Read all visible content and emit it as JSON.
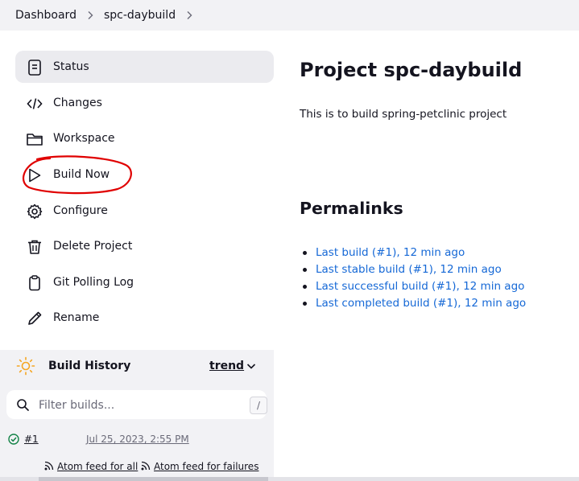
{
  "breadcrumb": {
    "items": [
      "Dashboard",
      "spc-daybuild"
    ]
  },
  "sidebar": {
    "items": [
      {
        "label": "Status",
        "icon": "document-icon",
        "active": true
      },
      {
        "label": "Changes",
        "icon": "code-icon"
      },
      {
        "label": "Workspace",
        "icon": "folder-icon"
      },
      {
        "label": "Build Now",
        "icon": "play-icon"
      },
      {
        "label": "Configure",
        "icon": "gear-icon"
      },
      {
        "label": "Delete Project",
        "icon": "trash-icon"
      },
      {
        "label": "Git Polling Log",
        "icon": "clipboard-icon"
      },
      {
        "label": "Rename",
        "icon": "pencil-icon"
      }
    ]
  },
  "build_history": {
    "title": "Build History",
    "trend_label": "trend",
    "filter_placeholder": "Filter builds...",
    "filter_shortcut": "/",
    "builds": [
      {
        "number": "#1",
        "date": "Jul 25, 2023, 2:55 PM",
        "status": "success"
      }
    ],
    "feeds": [
      "Atom feed for all",
      "Atom feed for failures"
    ]
  },
  "main": {
    "title": "Project spc-daybuild",
    "description": "This is to build spring-petclinic project",
    "permalinks_title": "Permalinks",
    "permalinks": [
      "Last build (#1), 12 min ago",
      "Last stable build (#1), 12 min ago",
      "Last successful build (#1), 12 min ago",
      "Last completed build (#1), 12 min ago"
    ]
  },
  "colors": {
    "link": "#1568d6",
    "annotation": "#e00000",
    "success": "#138347",
    "sun": "#f5a623"
  }
}
